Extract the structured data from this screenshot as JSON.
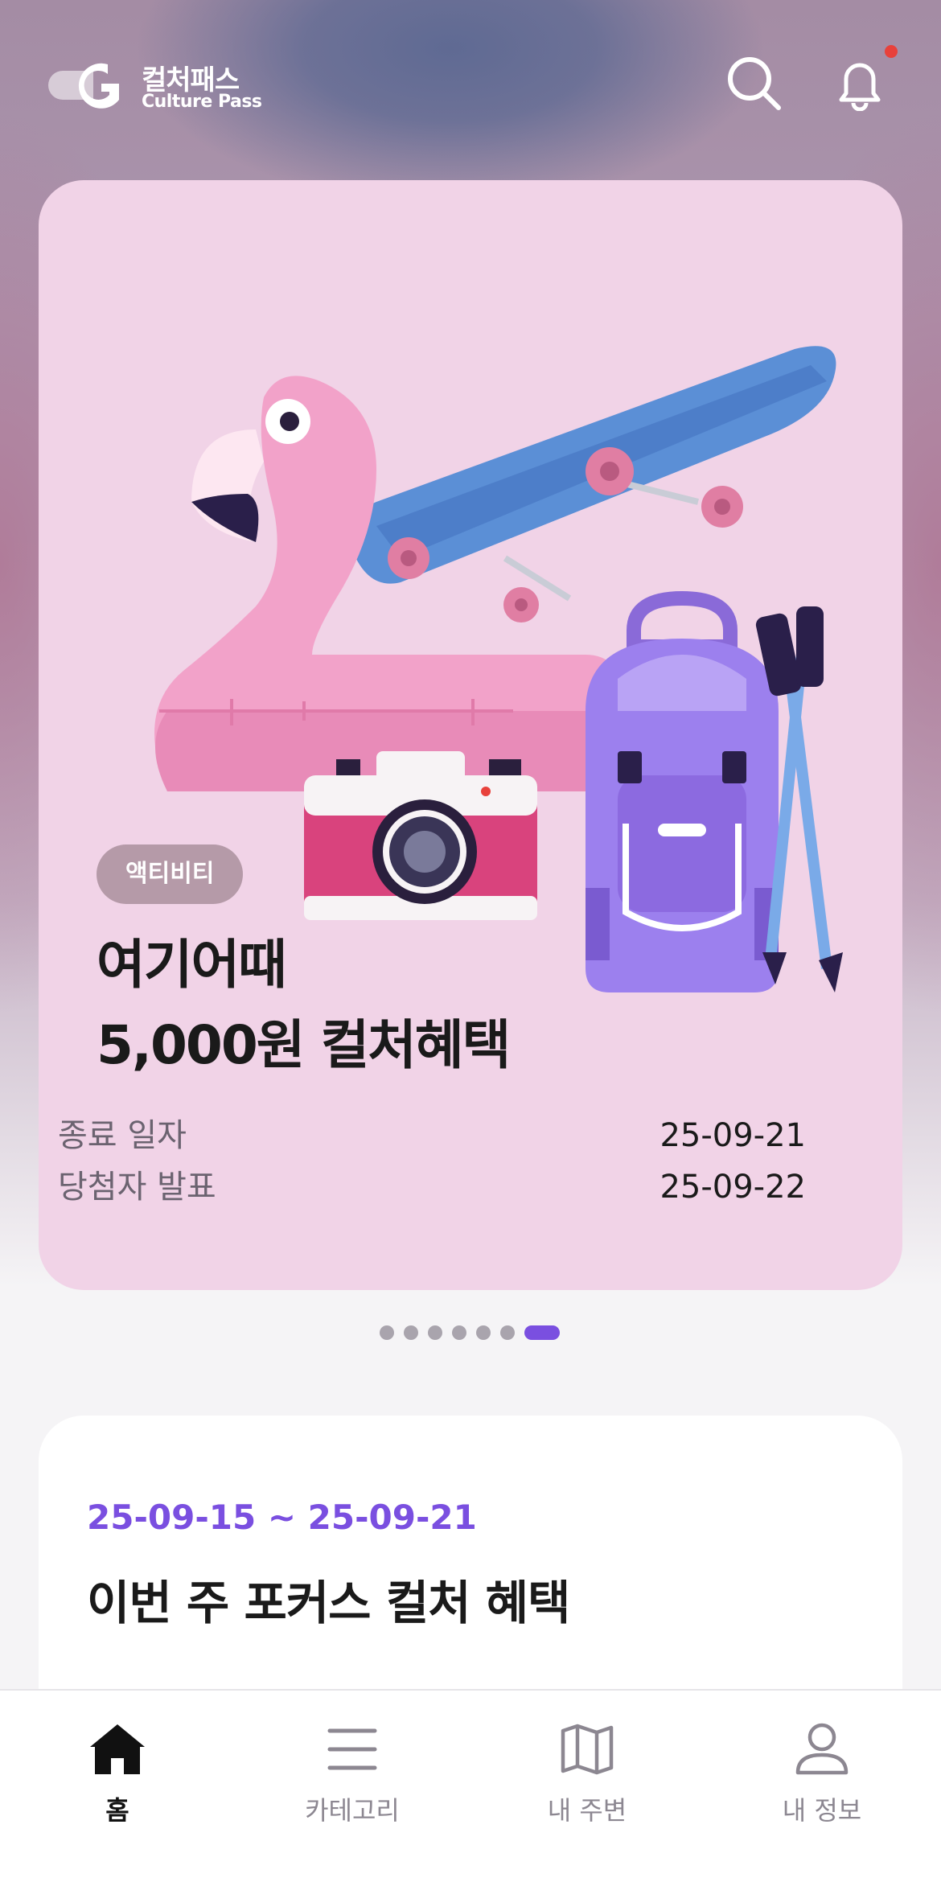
{
  "header": {
    "logo_ko": "컬처패스",
    "logo_en": "Culture Pass",
    "has_notification": true
  },
  "banner": {
    "tag": "액티비티",
    "title_line1": "여기어때",
    "title_line2": "5,000원 컬처혜택",
    "info": [
      {
        "label": "종료 일자",
        "value": "25-09-21"
      },
      {
        "label": "당첨자 발표",
        "value": "25-09-22"
      }
    ],
    "page_count": 7,
    "active_page": 7,
    "background_color": "#f1d3e7"
  },
  "focus": {
    "date_range": "25-09-15 ~ 25-09-21",
    "title": "이번 주 포커스 컬처 혜택"
  },
  "tabbar": {
    "items": [
      {
        "label": "홈",
        "icon": "home-icon",
        "active": true
      },
      {
        "label": "카테고리",
        "icon": "menu-icon",
        "active": false
      },
      {
        "label": "내 주변",
        "icon": "map-icon",
        "active": false
      },
      {
        "label": "내 정보",
        "icon": "user-icon",
        "active": false
      }
    ]
  },
  "colors": {
    "accent": "#7a4fe0",
    "notification_dot": "#e8413b",
    "tag_bg": "#b59aa8"
  }
}
